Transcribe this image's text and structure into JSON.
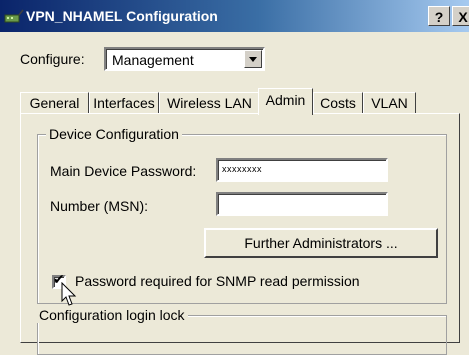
{
  "window": {
    "title": "VPN_NHAMEL Configuration",
    "help_label": "?",
    "close_label": "X"
  },
  "configure": {
    "label": "Configure:",
    "selected": "Management"
  },
  "tabs": [
    {
      "label": "General",
      "active": false
    },
    {
      "label": "Interfaces",
      "active": false
    },
    {
      "label": "Wireless LAN",
      "active": false
    },
    {
      "label": "Admin",
      "active": true
    },
    {
      "label": "Costs",
      "active": false
    },
    {
      "label": "VLAN",
      "active": false
    }
  ],
  "device_config": {
    "legend": "Device Configuration",
    "password_label": "Main Device Password:",
    "password_value": "xxxxxxxx",
    "msn_label": "Number (MSN):",
    "msn_value": "",
    "further_admins_label": "Further Administrators ...",
    "snmp_checkbox_label": "Password required for SNMP read permission",
    "snmp_checked": true
  },
  "login_lock": {
    "legend": "Configuration login lock"
  }
}
